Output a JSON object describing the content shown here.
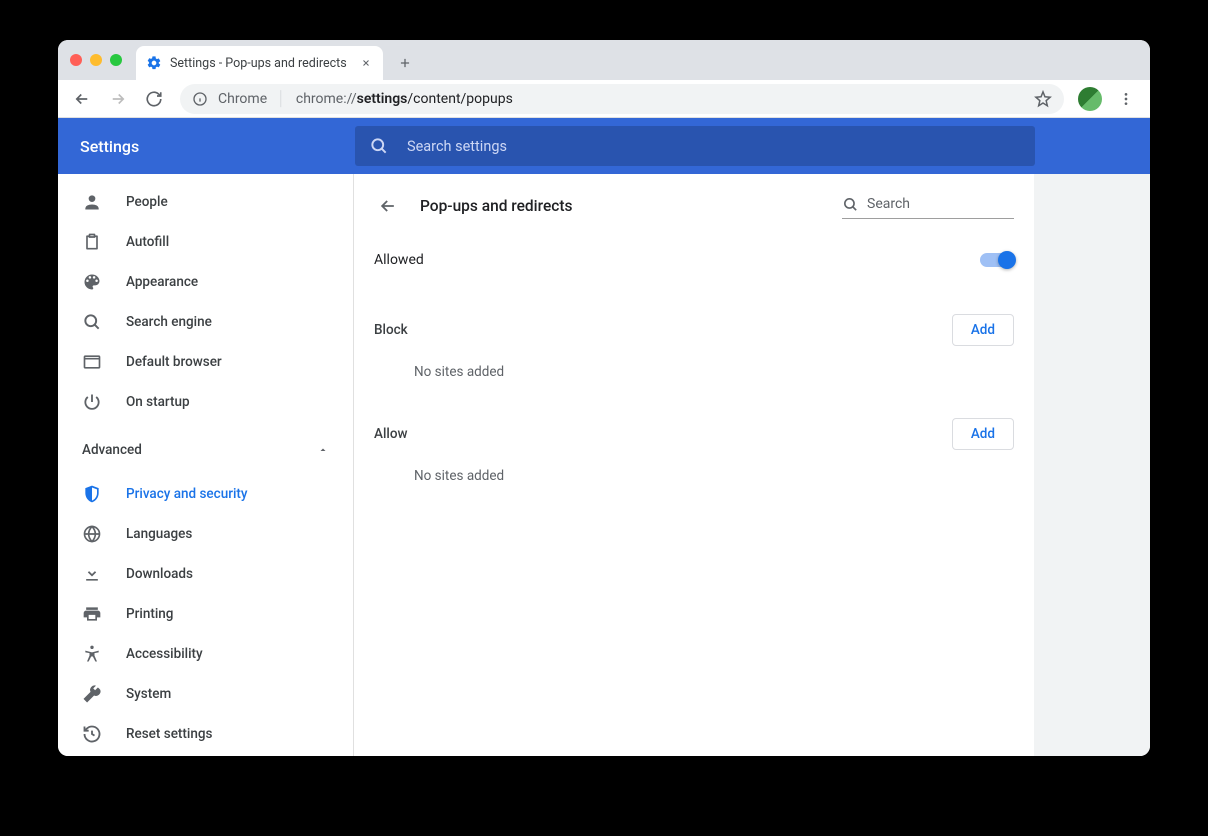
{
  "tab": {
    "title": "Settings - Pop-ups and redirects"
  },
  "omnibox": {
    "chrome_label": "Chrome",
    "url_proto": "chrome://",
    "url_bold": "settings",
    "url_rest": "/content/popups"
  },
  "header": {
    "app_title": "Settings",
    "search_placeholder": "Search settings"
  },
  "sidebar": {
    "items": [
      {
        "label": "People"
      },
      {
        "label": "Autofill"
      },
      {
        "label": "Appearance"
      },
      {
        "label": "Search engine"
      },
      {
        "label": "Default browser"
      },
      {
        "label": "On startup"
      }
    ],
    "advanced_label": "Advanced",
    "adv_items": [
      {
        "label": "Privacy and security"
      },
      {
        "label": "Languages"
      },
      {
        "label": "Downloads"
      },
      {
        "label": "Printing"
      },
      {
        "label": "Accessibility"
      },
      {
        "label": "System"
      },
      {
        "label": "Reset settings"
      }
    ]
  },
  "page": {
    "title": "Pop-ups and redirects",
    "search_placeholder": "Search",
    "toggle_label": "Allowed",
    "toggle_on": true,
    "block": {
      "heading": "Block",
      "add": "Add",
      "empty": "No sites added"
    },
    "allow": {
      "heading": "Allow",
      "add": "Add",
      "empty": "No sites added"
    }
  }
}
